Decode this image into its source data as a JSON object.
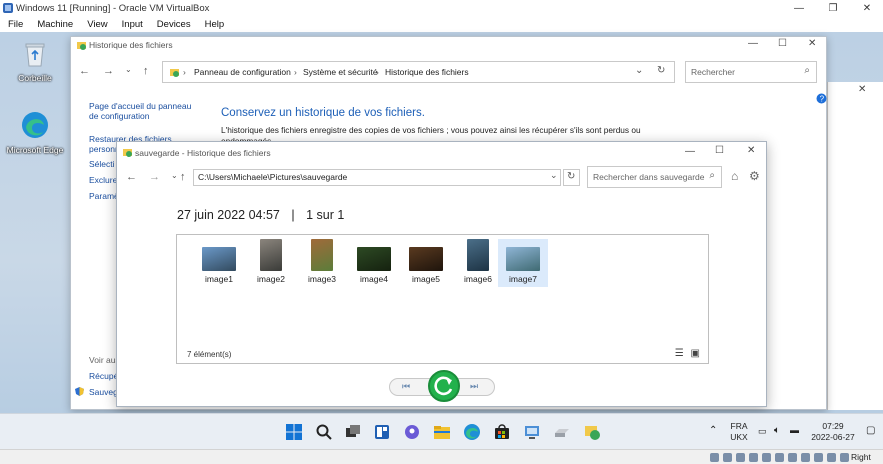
{
  "host": {
    "title": "Windows 11 [Running] - Oracle VM VirtualBox",
    "menu": [
      "File",
      "Machine",
      "View",
      "Input",
      "Devices",
      "Help"
    ],
    "controls": {
      "minimize": "—",
      "restore": "❐",
      "close": "✕"
    },
    "status_right": "Right Ctrl"
  },
  "desktop": {
    "icons": [
      {
        "label": "Corbeille",
        "icon": "recycle-bin-icon"
      },
      {
        "label": "Microsoft Edge",
        "icon": "edge-icon"
      }
    ]
  },
  "cp_window": {
    "title": "Historique des fichiers",
    "breadcrumb": [
      "Panneau de configuration",
      "Système et sécurité",
      "Historique des fichiers"
    ],
    "search_placeholder": "Rechercher",
    "sidebar": {
      "home": "Page d'accueil du panneau de configuration",
      "restore": "Restaurer des fichiers personn",
      "select": "Sélecti",
      "exclude": "Exclure",
      "params": "Paramè",
      "see_also": "Voir aus",
      "recovery": "Récupé",
      "backup": "Sauvega"
    },
    "heading": "Conservez un historique de vos fichiers.",
    "description": "L'historique des fichiers enregistre des copies de vos fichiers ; vous pouvez ainsi les récupérer s'ils sont perdus ou endommagés."
  },
  "fh_window": {
    "title": "sauvegarde - Historique des fichiers",
    "path": "C:\\Users\\Michaele\\Pictures\\sauvegarde",
    "search_placeholder": "Rechercher dans sauvegarde",
    "date": "27 juin 2022 04:57",
    "separator": "|",
    "position": "1 sur 1",
    "items": [
      {
        "name": "image1",
        "colors": [
          "#6b99c9",
          "#324a5e"
        ],
        "shape": "landscape"
      },
      {
        "name": "image2",
        "colors": [
          "#8b857d",
          "#3a3b38"
        ],
        "shape": "portrait"
      },
      {
        "name": "image3",
        "colors": [
          "#a06a3a",
          "#5b7d3a"
        ],
        "shape": "portrait"
      },
      {
        "name": "image4",
        "colors": [
          "#2d4a24",
          "#15210f"
        ],
        "shape": "landscape"
      },
      {
        "name": "image5",
        "colors": [
          "#5a3a20",
          "#1e140c"
        ],
        "shape": "landscape"
      },
      {
        "name": "image6",
        "colors": [
          "#4b6f89",
          "#1d3344"
        ],
        "shape": "portrait"
      },
      {
        "name": "image7",
        "colors": [
          "#8fb5d6",
          "#3f6a72"
        ],
        "shape": "landscape"
      }
    ],
    "count": "7 élément(s)",
    "selected_index": 6
  },
  "taskbar": {
    "lang_top": "FRA",
    "lang_bottom": "UKX",
    "time": "07:29",
    "date": "2022-06-27"
  },
  "colors": {
    "accent_blue": "#1d5fb7",
    "link_blue": "#1a4e9f",
    "restore_green": "#22b14c"
  }
}
